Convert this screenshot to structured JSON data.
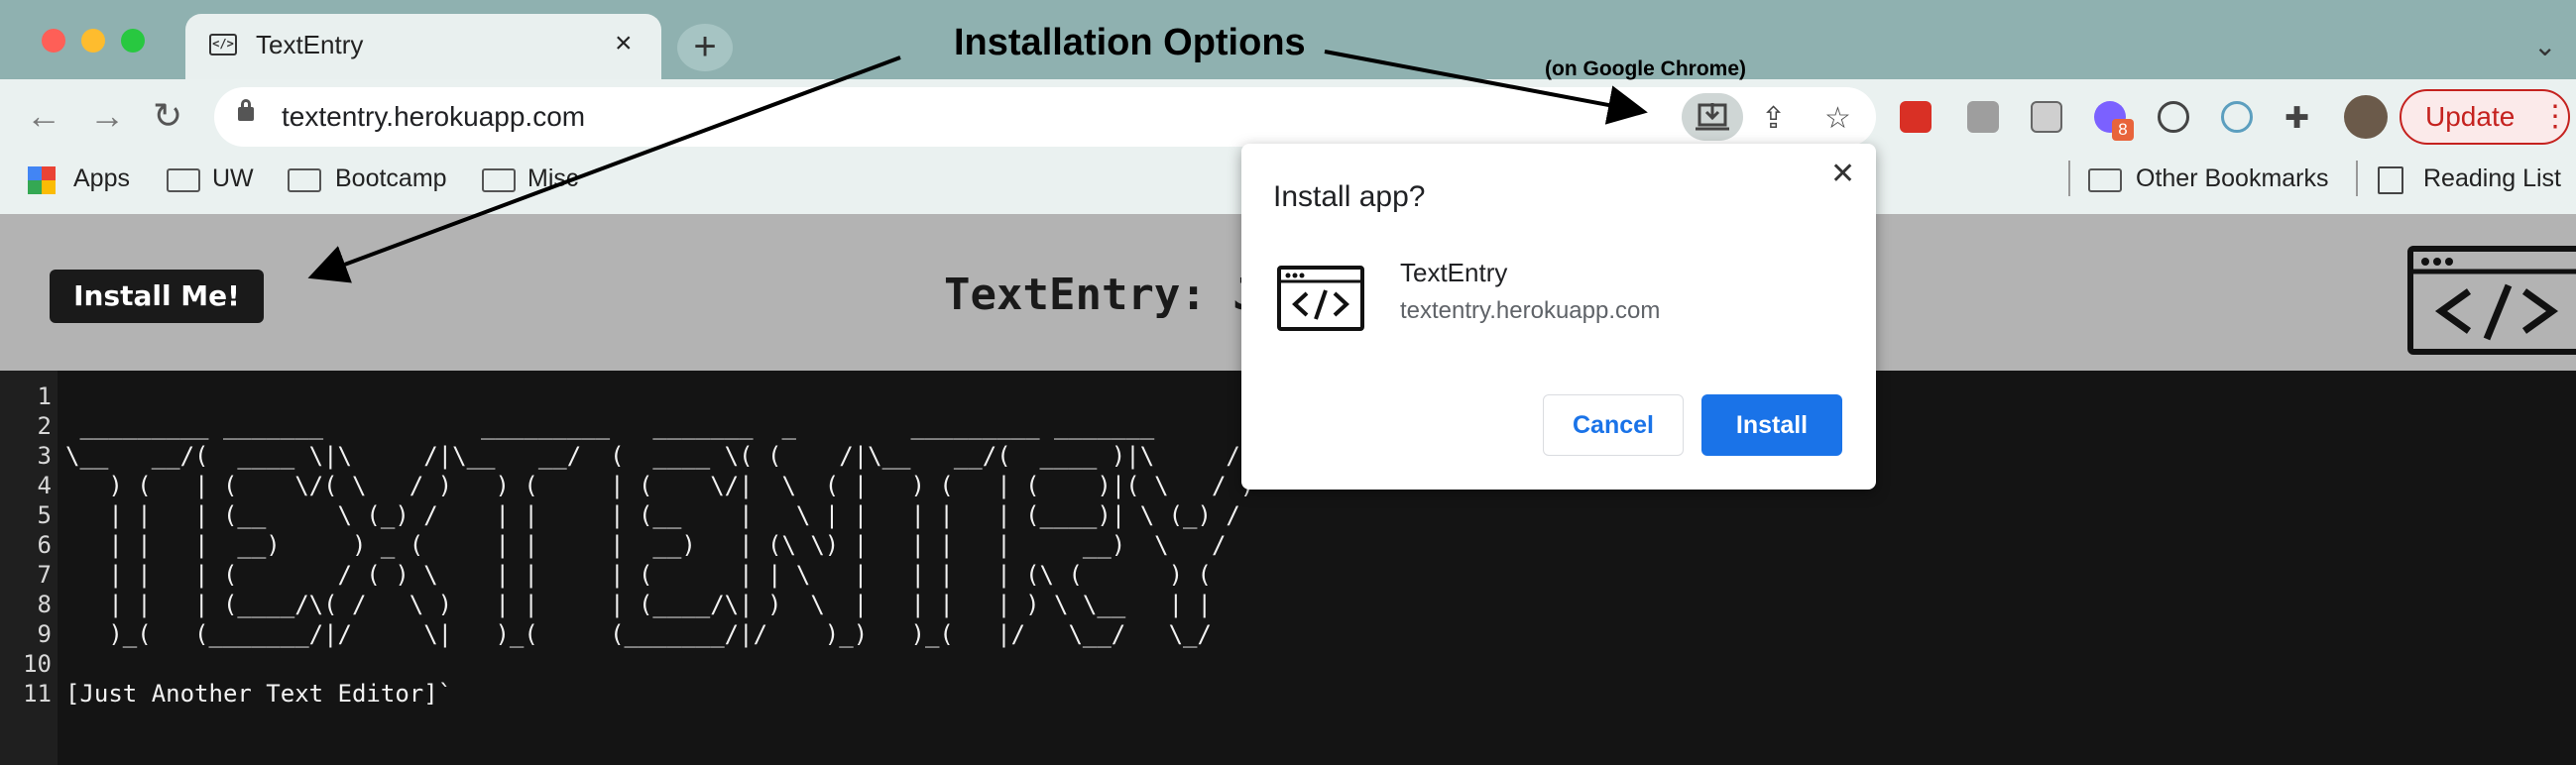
{
  "browser": {
    "tab_title": "TextEntry",
    "tab_close": "×",
    "new_tab": "+",
    "url": "textentry.herokuapp.com",
    "update_label": "Update",
    "update_menu": "⋮",
    "extension_badge": "8",
    "icons": [
      "back-icon",
      "forward-icon",
      "reload-icon",
      "lock-icon",
      "install-app-icon",
      "share-icon",
      "star-icon",
      "extensions-icon",
      "profile-avatar"
    ]
  },
  "bookmarks": {
    "items": [
      "Apps",
      "UW",
      "Bootcamp",
      "Misc"
    ],
    "other": "Other Bookmarks",
    "reading_list": "Reading List"
  },
  "page": {
    "install_button": "Install Me!",
    "title": "TextEntry: Ju"
  },
  "editor": {
    "line_numbers": [
      "1",
      "2",
      "3",
      "4",
      "5",
      "6",
      "7",
      "8",
      "9",
      "10",
      "11"
    ],
    "lines": [
      "",
      " _________ _______           _________   _______  _        _________ _______           ",
      "\\__   __/(  ____ \\|\\     /|\\__   __/  (  ____ \\( (    /|\\__   __/(  ____ )|\\     /|",
      "   ) (   | (    \\/( \\   / )   ) (     | (    \\/|  \\  ( |   ) (   | (    )|( \\   / )",
      "   | |   | (__     \\ (_) /    | |     | (__    |   \\ | |   | |   | (____)| \\ (_) / ",
      "   | |   |  __)     ) _ (     | |     |  __)   | (\\ \\) |   | |   |     __)  \\   /  ",
      "   | |   | (       / ( ) \\    | |     | (      | | \\   |   | |   | (\\ (      ) (   ",
      "   | |   | (____/\\( /   \\ )   | |     | (____/\\| )  \\  |   | |   | ) \\ \\__   | |   ",
      "   )_(   (_______/|/     \\|   )_(     (_______/|/    )_)   )_(   |/   \\__/   \\_/   ",
      "",
      "[Just Another Text Editor]`"
    ]
  },
  "dialog": {
    "title": "Install app?",
    "close": "✕",
    "app_name": "TextEntry",
    "app_url": "textentry.herokuapp.com",
    "cancel": "Cancel",
    "install": "Install"
  },
  "annotations": {
    "title": "Installation Options",
    "subtitle": "(on Google Chrome)"
  },
  "colors": {
    "accent_blue": "#1a73e8",
    "update_red": "#c5221f",
    "tabstrip": "#8fb1b0",
    "page_header": "#b3b3b3",
    "editor_bg": "#141414"
  }
}
